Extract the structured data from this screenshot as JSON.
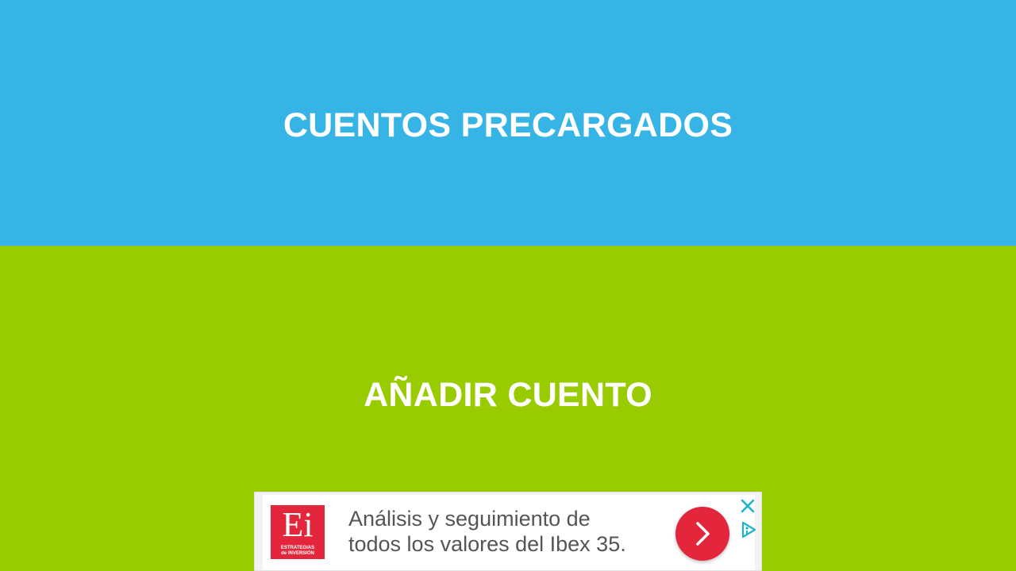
{
  "colors": {
    "top_panel": "#35b4e5",
    "bottom_panel": "#99cc00",
    "ad_accent": "#e3263b",
    "ad_icon": "#1fb3c8"
  },
  "menu": {
    "preloaded_label": "CUENTOS PRECARGADOS",
    "add_label": "AÑADIR CUENTO"
  },
  "ad": {
    "logo_mark": "Ei",
    "logo_sub_line1": "ESTRATEGIAS",
    "logo_sub_line2": "de INVERSIÓN",
    "text_line1": "Análisis y seguimiento de",
    "text_line2": "todos los valores del Ibex 35.",
    "cta_icon": "chevron-right-icon",
    "close_icon": "close-icon",
    "choices_icon": "ad-choices-icon"
  }
}
